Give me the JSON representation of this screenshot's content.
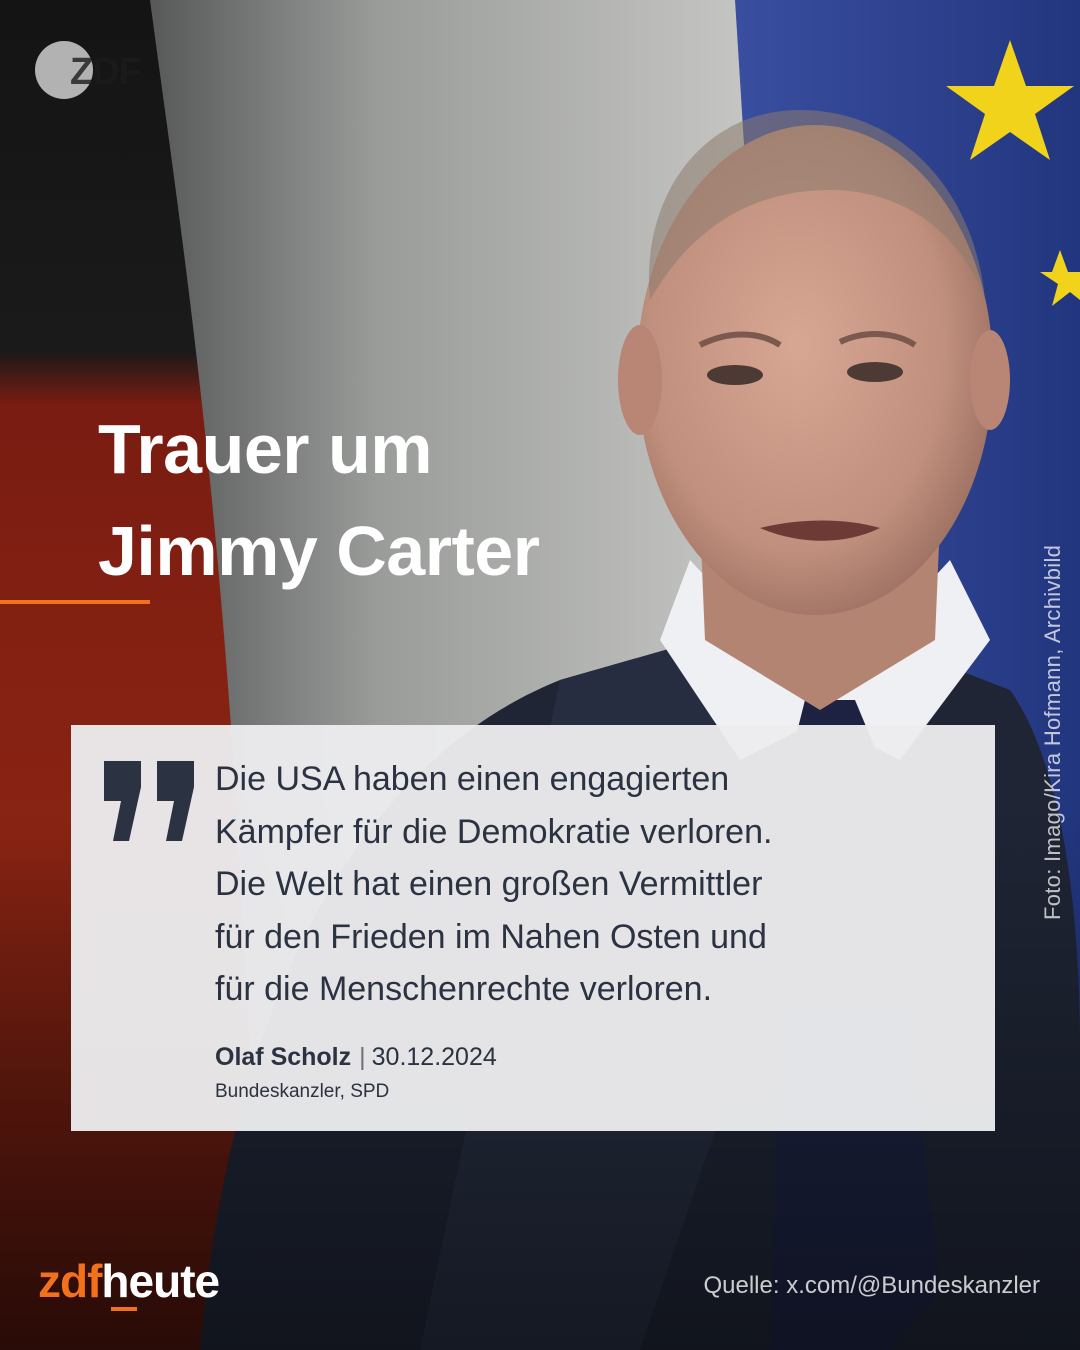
{
  "logo": {
    "icon": "zdf-logo-icon",
    "text": "ZDF"
  },
  "headline": {
    "line1": "Trauer um",
    "line2": "Jimmy Carter"
  },
  "photo_credit": "Foto: Imago/Kira Hofmann, Archivbild",
  "quote": {
    "icon": "quotation-mark-icon",
    "lines": [
      "Die USA haben einen engagierten",
      "Kämpfer für die Demokratie verloren.",
      "Die Welt hat einen großen Vermittler",
      "für den Frieden im Nahen Osten und",
      "für die Menschenrechte verloren."
    ],
    "author": "Olaf Scholz",
    "separator": "|",
    "date": "30.12.2024",
    "role": "Bundeskanzler, SPD"
  },
  "brand": {
    "part1": "zdf",
    "part2": "heute"
  },
  "source": "Quelle: x.com/@Bundeskanzler",
  "colors": {
    "accent": "#f2711c",
    "quote_text": "#2b3241",
    "card_background": "#ececee",
    "eu_blue": "#2a3f93",
    "eu_star": "#f2d31c"
  }
}
